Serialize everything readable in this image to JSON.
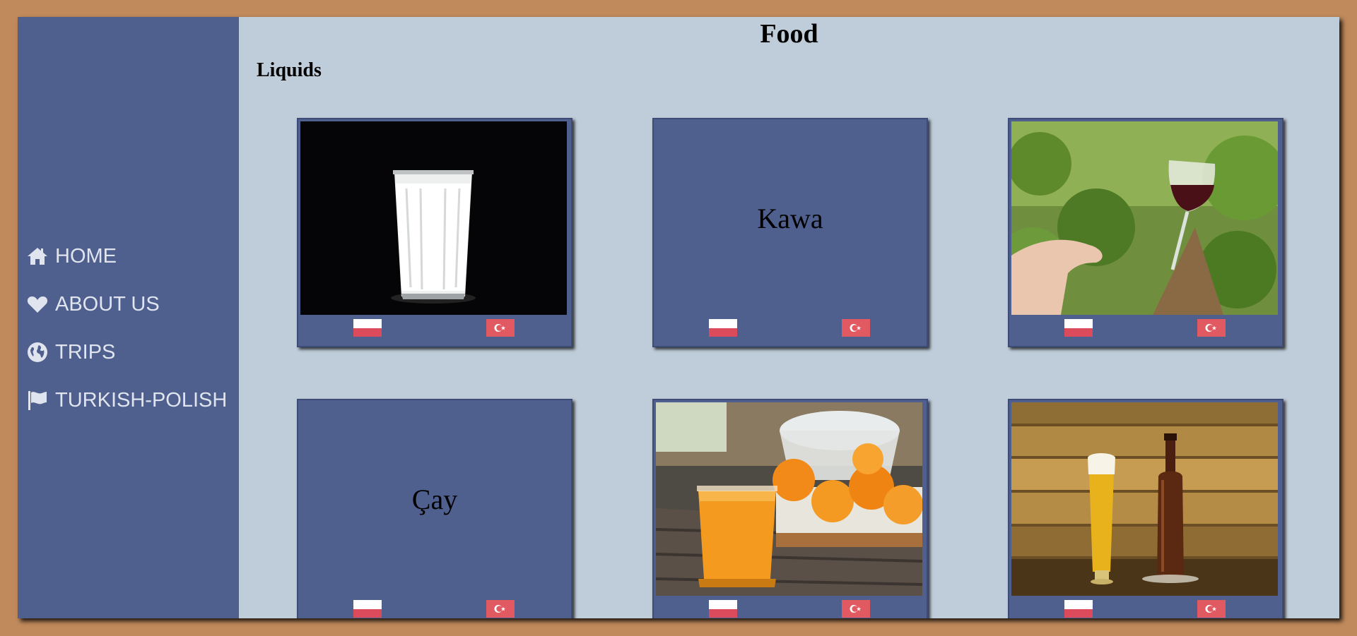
{
  "nav": {
    "items": [
      {
        "label": "HOME",
        "icon": "home-icon"
      },
      {
        "label": "ABOUT US",
        "icon": "heart-icon"
      },
      {
        "label": "TRIPS",
        "icon": "globe-icon"
      },
      {
        "label": "TURKISH-POLISH",
        "icon": "flag-icon"
      }
    ]
  },
  "page": {
    "title": "Food",
    "section": "Liquids"
  },
  "cards": [
    {
      "kind": "image",
      "image": "glass-of-milk"
    },
    {
      "kind": "text",
      "word": "Kawa"
    },
    {
      "kind": "image",
      "image": "glass-of-red-wine-in-vineyard"
    },
    {
      "kind": "text",
      "word": "Çay"
    },
    {
      "kind": "image",
      "image": "orange-juice-with-oranges"
    },
    {
      "kind": "image",
      "image": "beer-glass-and-bottle"
    }
  ],
  "flags": {
    "left": "poland-flag",
    "right": "turkey-flag"
  },
  "colors": {
    "background": "#c08a5c",
    "sidebar": "#4f5f8e",
    "main": "#bfccd9",
    "card": "#4f5f8e",
    "nav_text": "#dfe4ef"
  }
}
